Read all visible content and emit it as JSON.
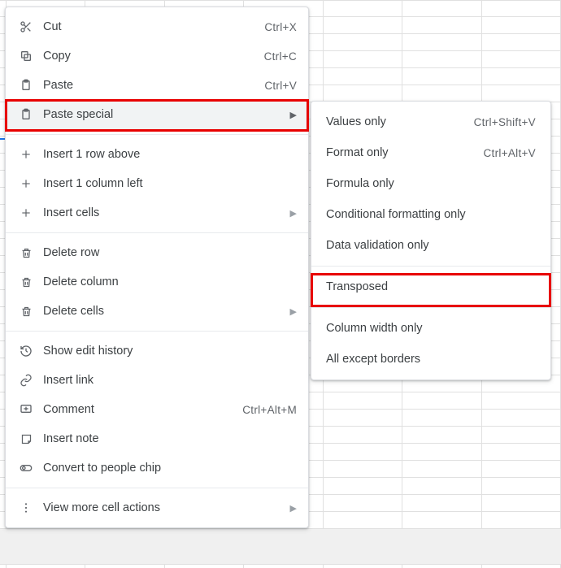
{
  "menu": {
    "cut": {
      "label": "Cut",
      "shortcut": "Ctrl+X"
    },
    "copy": {
      "label": "Copy",
      "shortcut": "Ctrl+C"
    },
    "paste": {
      "label": "Paste",
      "shortcut": "Ctrl+V"
    },
    "paste_special": {
      "label": "Paste special"
    },
    "insert_row_above": {
      "label": "Insert 1 row above"
    },
    "insert_col_left": {
      "label": "Insert 1 column left"
    },
    "insert_cells": {
      "label": "Insert cells"
    },
    "delete_row": {
      "label": "Delete row"
    },
    "delete_col": {
      "label": "Delete column"
    },
    "delete_cells": {
      "label": "Delete cells"
    },
    "edit_history": {
      "label": "Show edit history"
    },
    "insert_link": {
      "label": "Insert link"
    },
    "comment": {
      "label": "Comment",
      "shortcut": "Ctrl+Alt+M"
    },
    "insert_note": {
      "label": "Insert note"
    },
    "people_chip": {
      "label": "Convert to people chip"
    },
    "more_actions": {
      "label": "View more cell actions"
    }
  },
  "submenu": {
    "values_only": {
      "label": "Values only",
      "shortcut": "Ctrl+Shift+V"
    },
    "format_only": {
      "label": "Format only",
      "shortcut": "Ctrl+Alt+V"
    },
    "formula_only": {
      "label": "Formula only"
    },
    "cond_fmt_only": {
      "label": "Conditional formatting only"
    },
    "dv_only": {
      "label": "Data validation only"
    },
    "transposed": {
      "label": "Transposed"
    },
    "colwidth_only": {
      "label": "Column width only"
    },
    "all_except_borders": {
      "label": "All except borders"
    }
  }
}
